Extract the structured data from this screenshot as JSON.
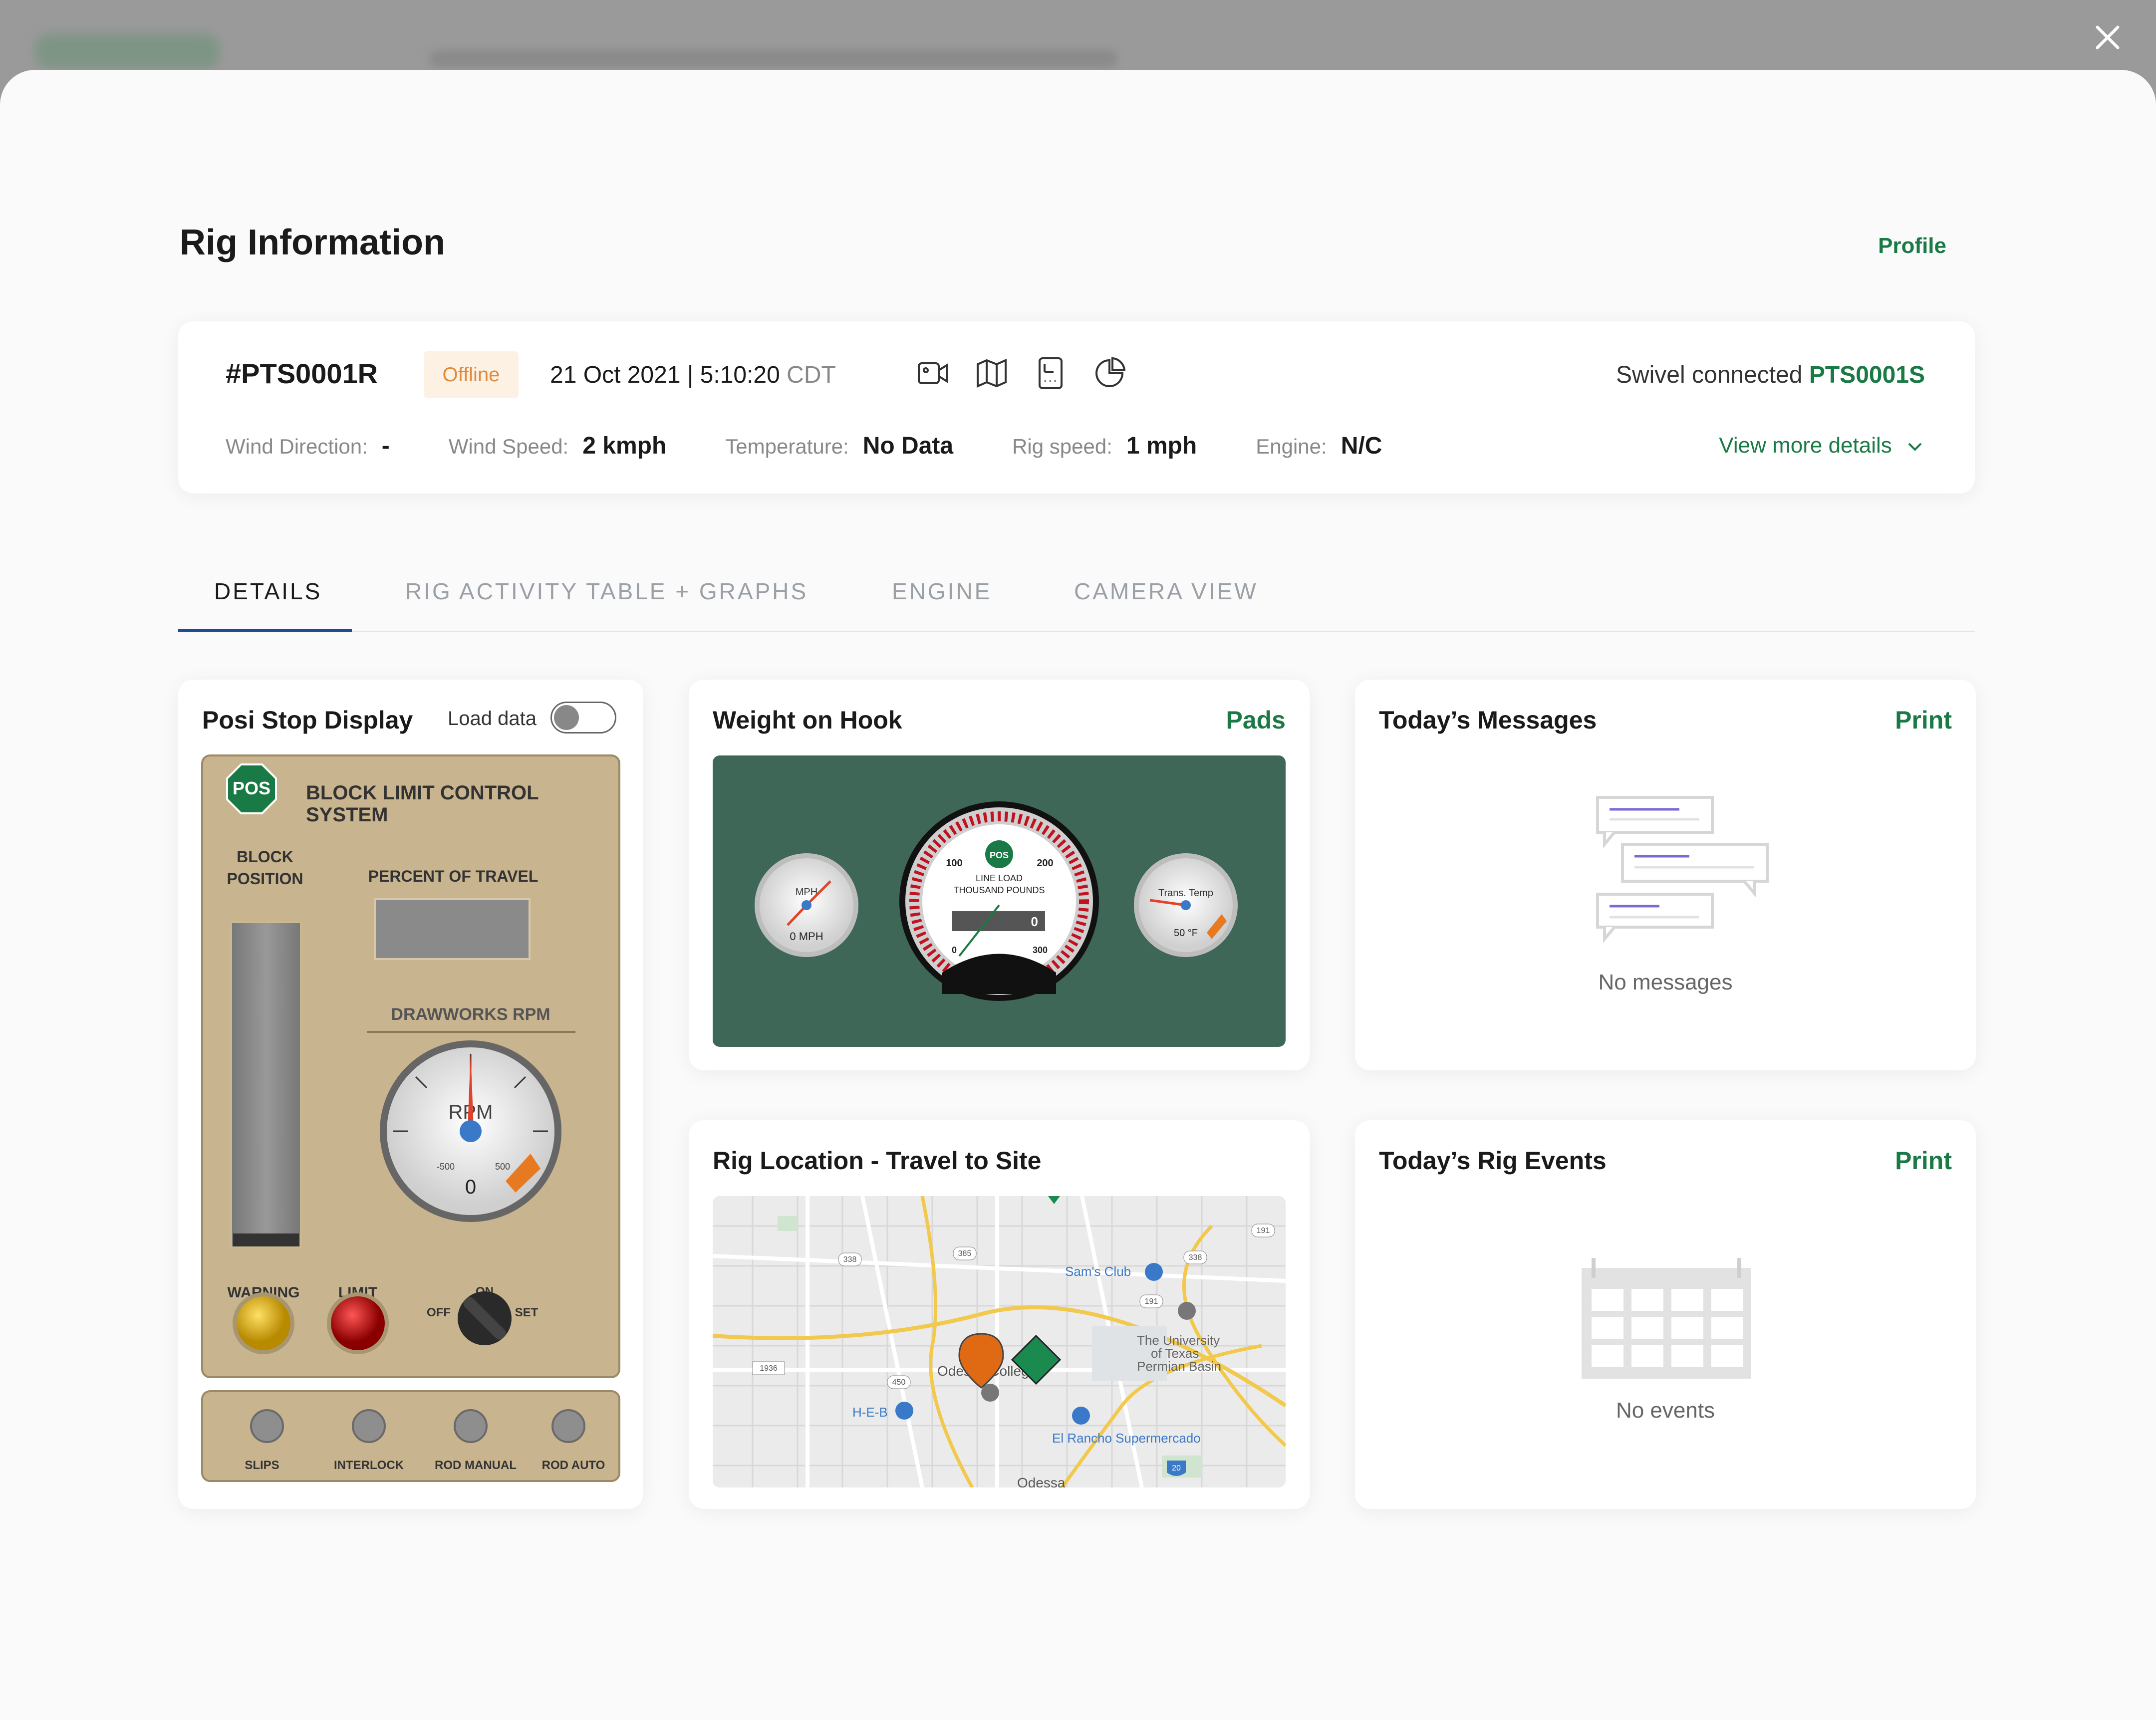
{
  "modal": {
    "title": "Rig Information",
    "profile_link": "Profile"
  },
  "rig": {
    "id": "#PTS0001R",
    "status": "Offline",
    "date_time": "21 Oct 2021  |  5:10:20",
    "timezone": "CDT",
    "swivel_label": "Swivel connected",
    "swivel_id": "PTS0001S",
    "view_more": "View more details",
    "stats": [
      {
        "label": "Wind Direction:",
        "value": "-"
      },
      {
        "label": "Wind Speed:",
        "value": "2 kmph"
      },
      {
        "label": "Temperature:",
        "value": "No Data"
      },
      {
        "label": "Rig speed:",
        "value": "1 mph"
      },
      {
        "label": "Engine:",
        "value": "N/C"
      }
    ],
    "header_icons": [
      "video-camera-icon",
      "map-icon",
      "device-icon",
      "pie-chart-icon"
    ]
  },
  "tabs": [
    {
      "label": "DETAILS",
      "active": true
    },
    {
      "label": "RIG ACTIVITY TABLE + GRAPHS",
      "active": false
    },
    {
      "label": "ENGINE",
      "active": false
    },
    {
      "label": "CAMERA VIEW",
      "active": false
    }
  ],
  "posi_stop": {
    "title": "Posi Stop Display",
    "toggle_label": "Load data",
    "toggle_on": false,
    "panel": {
      "logo": "POS",
      "system_title_1": "BLOCK LIMIT CONTROL",
      "system_title_2": "SYSTEM",
      "block_position_1": "BLOCK",
      "block_position_2": "POSITION",
      "percent_of_travel": "PERCENT OF TRAVEL",
      "drawworks_rpm": "DRAWWORKS RPM",
      "rpm_label": "RPM",
      "rpm_value": "0",
      "rpm_min": "-500",
      "rpm_max": "500",
      "warning": "WARNING",
      "limit": "LIMIT",
      "switch_on": "ON",
      "switch_off": "OFF",
      "switch_set": "SET",
      "indicators": [
        "SLIPS",
        "INTERLOCK",
        "ROD MANUAL",
        "ROD AUTO"
      ]
    }
  },
  "weight_on_hook": {
    "title": "Weight on Hook",
    "link": "Pads",
    "speed_gauge": {
      "label": "MPH",
      "value": "0 MPH"
    },
    "load_gauge": {
      "logo": "POS",
      "label_1": "LINE LOAD",
      "label_2": "THOUSAND POUNDS",
      "tick_100": "100",
      "tick_200": "200",
      "tick_300": "300",
      "tick_0": "0",
      "readout": "0"
    },
    "temp_gauge": {
      "label": "Trans. Temp",
      "value": "50 °F"
    }
  },
  "messages": {
    "title": "Today’s Messages",
    "link": "Print",
    "empty": "No messages"
  },
  "location": {
    "title": "Rig Location - Travel to Site",
    "places": [
      "Sam's Club",
      "The University",
      "of Texas",
      "Permian Basin",
      "Odessa College",
      "H-E-B",
      "El Rancho Supermercado",
      "Odessa"
    ],
    "roads": [
      "338",
      "385",
      "191",
      "338",
      "191",
      "1936",
      "450",
      "20",
      "338",
      "191"
    ]
  },
  "events": {
    "title": "Today’s Rig Events",
    "link": "Print",
    "empty": "No events"
  },
  "colors": {
    "accent_green": "#1a7a46",
    "tab_active": "#1f4a96",
    "gauge_bg": "#3f6757",
    "panel_tan": "#c8b48e",
    "offline_badge": "#fdf1e3"
  }
}
